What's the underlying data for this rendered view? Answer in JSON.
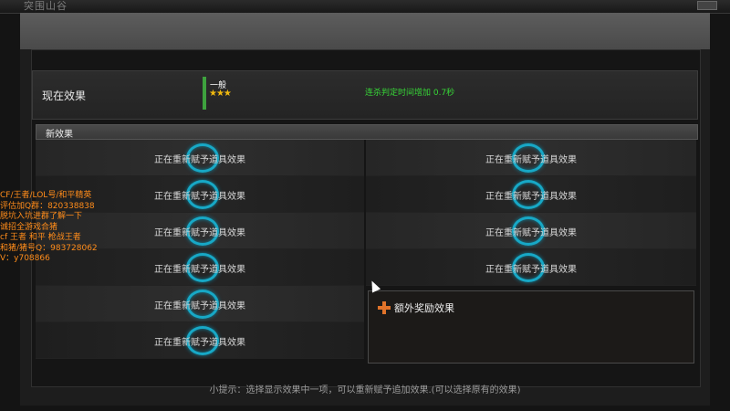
{
  "window": {
    "title": "突围山谷"
  },
  "current": {
    "label": "现在效果",
    "level": "一般",
    "stars": "★★★",
    "description": "连杀判定时间增加 0.7秒"
  },
  "new_effects": {
    "header": "新效果",
    "left": [
      "正在重新赋予道具效果",
      "正在重新赋予道具效果",
      "正在重新赋予道具效果",
      "正在重新赋予道具效果",
      "正在重新赋予道具效果",
      "正在重新赋予道具效果"
    ],
    "right": [
      "正在重新赋予道具效果",
      "正在重新赋予道具效果",
      "正在重新赋予道具效果",
      "正在重新赋予道具效果"
    ],
    "bonus_title": "额外奖励效果"
  },
  "hint": "小提示：选择显示效果中一项，可以重新赋予追加效果.(可以选择原有的效果)",
  "overlay_lines": [
    "CF/王者/LOL号/和平精英",
    "评估加Q群：820338838",
    "脱坑入坑进群了解一下",
    "诚招全游戏合猪",
    "cf 王者 和平 枪战王者",
    "和猪/猪号Q：983728062",
    "V：y708866"
  ],
  "colors": {
    "ring": "#17a8c6",
    "desc": "#37d637",
    "overlay": "#ff8c1a",
    "stars": "#f0b90f",
    "badge": "#3ea23e"
  }
}
